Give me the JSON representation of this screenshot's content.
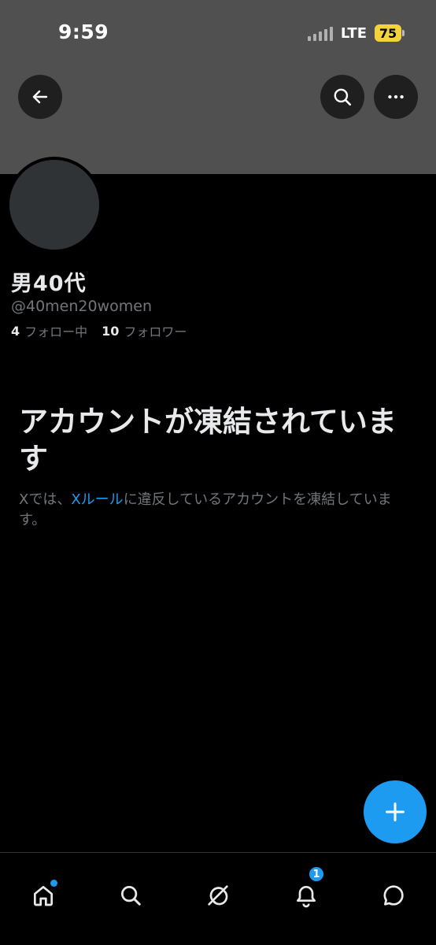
{
  "status_bar": {
    "time": "9:59",
    "network": "LTE",
    "battery": "75",
    "battery_color": "#f4d23c"
  },
  "header": {
    "back_icon": "arrow-left-icon",
    "search_icon": "search-icon",
    "more_icon": "more-horizontal-icon",
    "banner_color": "#505050"
  },
  "profile": {
    "display_name": "男40代",
    "handle": "@40men20women",
    "following_count": "4",
    "following_label": "フォロー中",
    "followers_count": "10",
    "followers_label": "フォロワー"
  },
  "suspension": {
    "title": "アカウントが凍結されています",
    "desc_prefix": "Xでは、",
    "desc_link": "Xルール",
    "desc_suffix": "に違反しているアカウントを凍結しています。",
    "link_color": "#1d9bf0"
  },
  "fab": {
    "icon": "plus-icon",
    "color": "#1d9bf0"
  },
  "bottom_nav": {
    "items": [
      {
        "name": "home",
        "icon": "home-icon",
        "has_dot": true
      },
      {
        "name": "search",
        "icon": "search-icon"
      },
      {
        "name": "grok",
        "icon": "grok-icon"
      },
      {
        "name": "notifications",
        "icon": "bell-icon",
        "badge": "1"
      },
      {
        "name": "messages",
        "icon": "message-icon"
      }
    ]
  }
}
